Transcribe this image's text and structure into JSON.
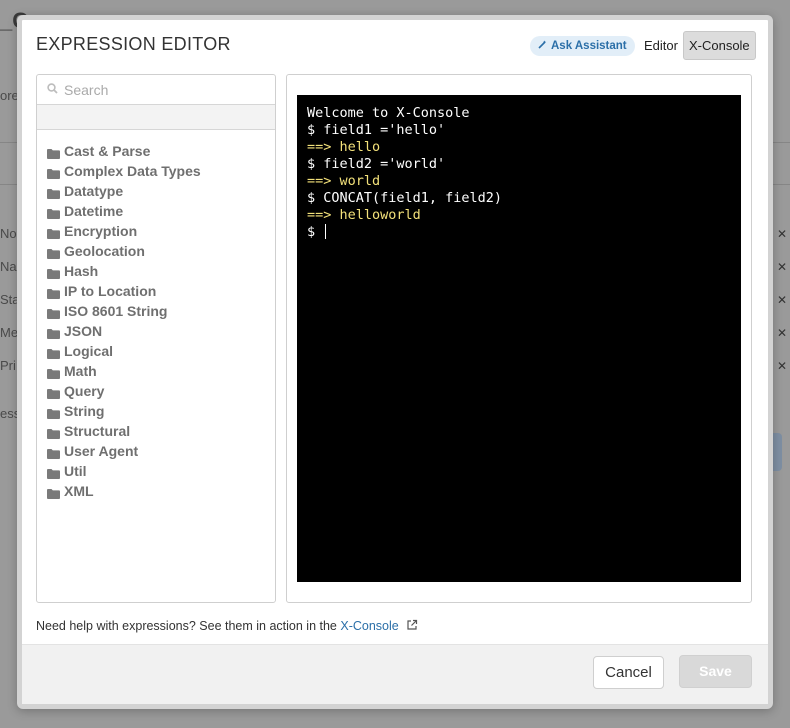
{
  "background": {
    "title_fragment": "_Co",
    "side_fragments": [
      "ore",
      "No",
      "Na",
      "Sta",
      "Me",
      "Pri",
      "ess"
    ],
    "row_close_icon": "close-icon"
  },
  "modal": {
    "title": "EXPRESSION EDITOR",
    "assistant_button": {
      "icon": "wand-icon",
      "label": "Ask Assistant"
    },
    "tabs": [
      {
        "label": "Editor",
        "active": false
      },
      {
        "label": "X-Console",
        "active": true
      }
    ]
  },
  "sidebar": {
    "search_placeholder": "Search",
    "search_icon": "search-icon",
    "folder_icon": "folder-icon",
    "categories": [
      "Cast & Parse",
      "Complex Data Types",
      "Datatype",
      "Datetime",
      "Encryption",
      "Geolocation",
      "Hash",
      "IP to Location",
      "ISO 8601 String",
      "JSON",
      "Logical",
      "Math",
      "Query",
      "String",
      "Structural",
      "User Agent",
      "Util",
      "XML"
    ]
  },
  "console": {
    "lines": [
      {
        "kind": "cmd",
        "text": "Welcome to X-Console"
      },
      {
        "kind": "cmd",
        "text": "$ field1 ='hello'"
      },
      {
        "kind": "out",
        "text": "==> hello"
      },
      {
        "kind": "cmd",
        "text": "$ field2 ='world'"
      },
      {
        "kind": "out",
        "text": "==> world"
      },
      {
        "kind": "cmd",
        "text": "$ CONCAT(field1, field2)"
      },
      {
        "kind": "out",
        "text": "==> helloworld"
      }
    ],
    "prompt": "$",
    "colors": {
      "background": "#000000",
      "command": "#ffffff",
      "output": "#f3e17a"
    }
  },
  "help": {
    "text": "Need help with expressions? See them in action in the",
    "link_label": "X-Console",
    "link_icon": "external-link-icon"
  },
  "footer": {
    "cancel_label": "Cancel",
    "save_label": "Save"
  }
}
